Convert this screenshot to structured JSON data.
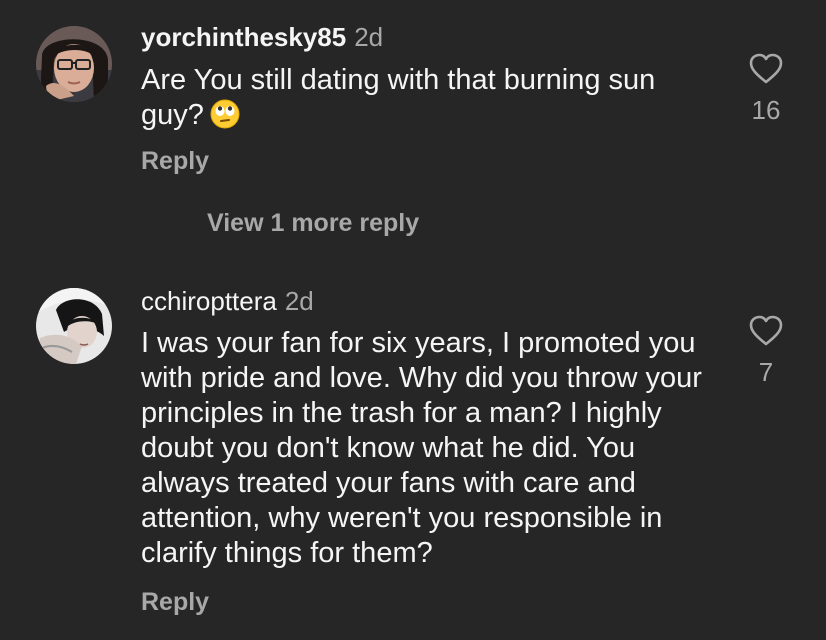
{
  "comments": [
    {
      "username": "yorchinthesky85",
      "age": "2d",
      "text": "Are You still dating with that burning sun guy?",
      "emoji": "face-with-rolling-eyes",
      "reply_label": "Reply",
      "likes": "16"
    },
    {
      "username": "cchiropttera",
      "age": "2d",
      "text": "I was your fan for six years, I promoted you with pride and love. Why did you throw your principles in the trash for a man? I highly doubt you don't know what he did. You always treated your fans with care and attention, why weren't you responsible in clarify things for them?",
      "reply_label": "Reply",
      "likes": "7"
    }
  ],
  "view_more_replies": "View 1 more reply",
  "colors": {
    "background": "#262626",
    "primary_text": "#f5f5f5",
    "secondary_text": "#a8a8a8"
  }
}
